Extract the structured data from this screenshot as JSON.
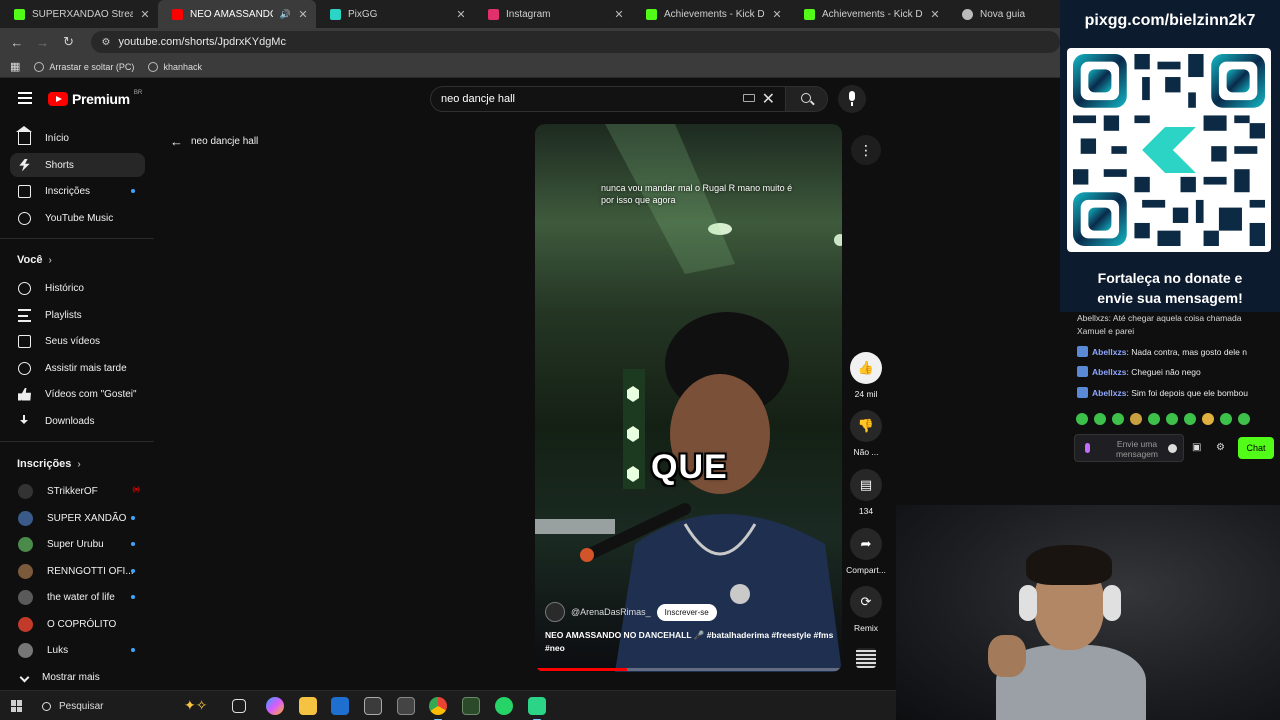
{
  "browser": {
    "tabs": [
      {
        "label": "SUPERXANDAO Stream - Watch",
        "favicon_color": "#53fc18",
        "active": false
      },
      {
        "label": "NEO AMASSANDO NO DANCE",
        "favicon_color": "#ff0000",
        "active": true
      },
      {
        "label": "PixGG",
        "favicon_color": "#2bd4c4",
        "active": false
      },
      {
        "label": "Instagram",
        "favicon_color": "#e1306c",
        "active": false
      },
      {
        "label": "Achievements - Kick Dashboard",
        "favicon_color": "#53fc18",
        "active": false
      },
      {
        "label": "Achievements - Kick Dashboard",
        "favicon_color": "#53fc18",
        "active": false
      },
      {
        "label": "Nova guia",
        "favicon_color": "#bbbbbb",
        "active": false
      }
    ],
    "url": "youtube.com/shorts/JpdrxKYdgMc",
    "bookmarks": [
      "Arrastar e soltar (PC)",
      "khanhack"
    ]
  },
  "youtube": {
    "logo_text": "Premium",
    "logo_country": "BR",
    "search": {
      "value": "neo dancje hall"
    },
    "sidebar": {
      "main": [
        "Início",
        "Shorts",
        "Inscrições",
        "YouTube Music"
      ],
      "you_heading": "Você",
      "you": [
        "Histórico",
        "Playlists",
        "Seus vídeos",
        "Assistir mais tarde",
        "Vídeos com \"Gostei\"",
        "Downloads"
      ],
      "subs_heading": "Inscrições",
      "subs": [
        {
          "name": "STrikkerOF",
          "color": "#333333"
        },
        {
          "name": "SUPER XANDÃO",
          "color": "#3a5a8a"
        },
        {
          "name": "Super Urubu",
          "color": "#4a8a4a"
        },
        {
          "name": "RENNGOTTI OFI...",
          "color": "#7a5a3a"
        },
        {
          "name": "the water of life",
          "color": "#5a5a5a"
        },
        {
          "name": "O COPRÓLITO",
          "color": "#c23a2a"
        },
        {
          "name": "Luks",
          "color": "#777777"
        }
      ],
      "show_more": "Mostrar mais"
    },
    "back_label": "neo dancje hall",
    "short": {
      "caption": "nunca vou mandar mal o Rugal R mano muito é por isso que agora",
      "big_word": "QUE",
      "channel": "@ArenaDasRimas_",
      "subscribe": "Inscrever-se",
      "title": "NEO AMASSANDO NO DANCEHALL 🎤 #batalhaderima #freestyle #fms #neo",
      "progress": 0.3
    },
    "actions": {
      "likes": "24 mil",
      "dislike": "Não ...",
      "comments": "134",
      "share": "Compart...",
      "remix": "Remix"
    }
  },
  "overlay": {
    "url": "pixgg.com/bielzinn2k7",
    "message_line1": "Fortaleça no donate e",
    "message_line2": "envie sua mensagem!"
  },
  "chat": {
    "messages": [
      {
        "user": "",
        "text": "Abellxzs: Até chegar aquela coisa chamada Xamuel e parei"
      },
      {
        "user": "Abellxzs",
        "text": ": Nada contra, mas gosto dele n"
      },
      {
        "user": "Abellxzs",
        "text": ": Cheguei não nego"
      },
      {
        "user": "Abellxzs",
        "text": ": Sim foi depois que ele bombou"
      }
    ],
    "placeholder_line1": "Envie uma",
    "placeholder_line2": "mensagem",
    "send_label": "Chat"
  },
  "taskbar": {
    "search_label": "Pesquisar"
  }
}
